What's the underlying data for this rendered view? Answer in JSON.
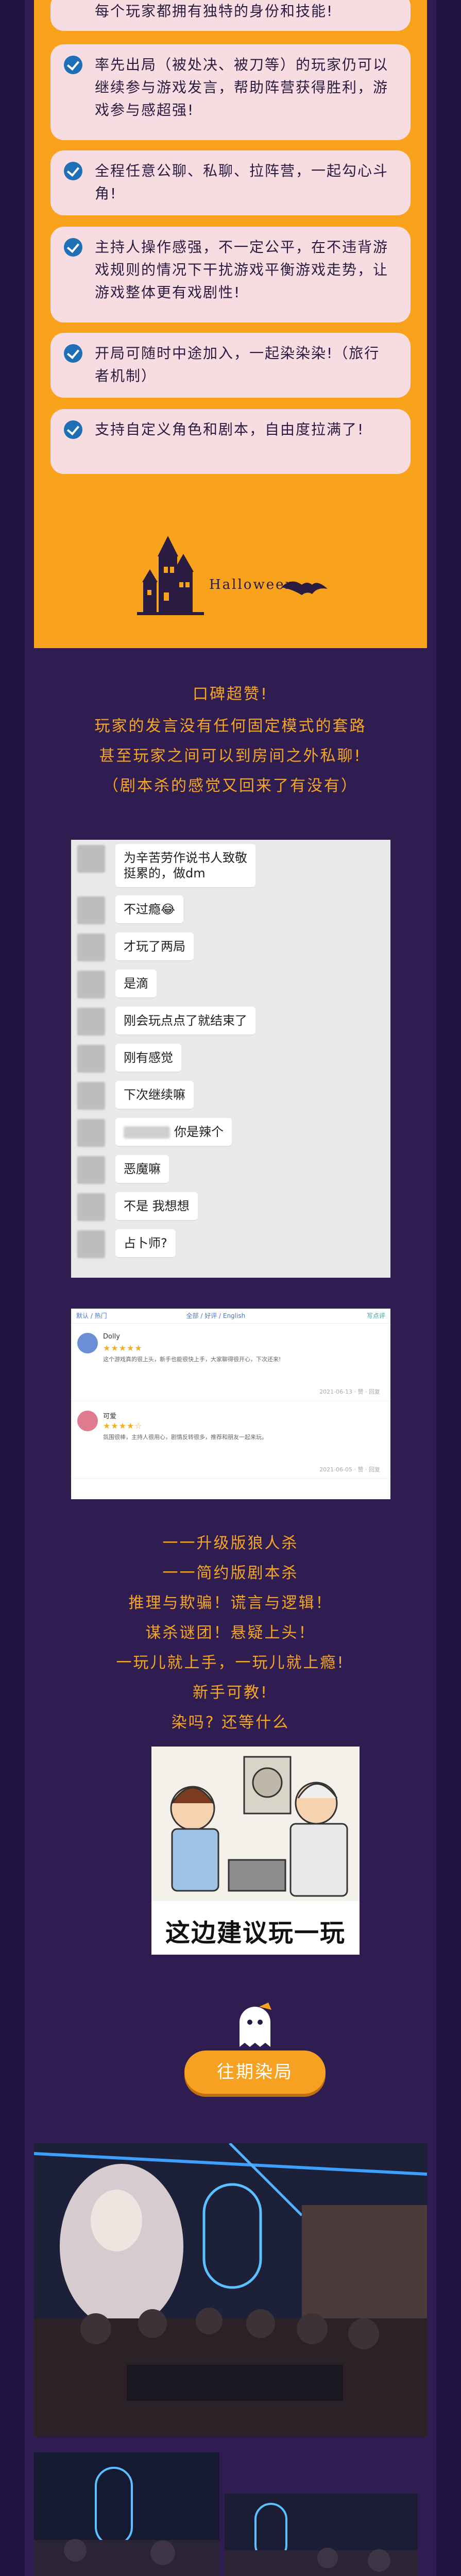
{
  "features": [
    "每个玩家都拥有独特的身份和技能!",
    "率先出局（被处决、被刀等）的玩家仍可以继续参与游戏发言，帮助阵营获得胜利，游戏参与感超强!",
    "全程任意公聊、私聊、拉阵营，一起勾心斗角!",
    "主持人操作感强，不一定公平，在不违背游戏规则的情况下干扰游戏平衡游戏走势，让游戏整体更有戏剧性!",
    "开局可随时中途加入，一起染染染!（旅行者机制）",
    "支持自定义角色和剧本，自由度拉满了!"
  ],
  "halloween_label": "Halloween",
  "praise": {
    "line1": "口碑超赞!",
    "line2": "玩家的发言没有任何固定模式的套路",
    "line3": "甚至玩家之间可以到房间之外私聊!",
    "line4": "（剧本杀的感觉又回来了有没有）"
  },
  "chat": {
    "messages": [
      {
        "text": "为辛苦劳作说书人致敬\n挺累的，做dm"
      },
      {
        "text": "不过瘾😂"
      },
      {
        "text": "才玩了两局"
      },
      {
        "text": "是滴"
      },
      {
        "text": "刚会玩点点了就结束了"
      },
      {
        "text": "刚有感觉"
      },
      {
        "text": "下次继续嘛"
      },
      {
        "text": "你是辣个"
      },
      {
        "text": "恶魔嘛"
      },
      {
        "text": "不是 我想想"
      },
      {
        "text": "占卜师?"
      }
    ]
  },
  "reviews": {
    "top_left": "默认 / 热门",
    "top_mid": "全部 / 好评 / English",
    "top_right": "写点评",
    "items": [
      {
        "name": "Dolly",
        "stars": "★★★★★",
        "body": "这个游戏真的很上头，新手也能很快上手，大家聊得很开心，下次还来!",
        "meta": "2021-06-13 · 赞 · 回复"
      },
      {
        "name": "可爱",
        "stars": "★★★★☆",
        "body": "氛围很棒，主持人很用心，剧情反转很多，推荐和朋友一起来玩。",
        "meta": "2021-06-05 · 赞 · 回复"
      }
    ]
  },
  "slogans": [
    "一一升级版狼人杀",
    "一一简约版剧本杀",
    "推理与欺骗！谎言与逻辑！",
    "谋杀谜团！悬疑上头！",
    "一玩儿就上手，一玩儿就上瘾!",
    "新手可教!",
    "染吗? 还等什么"
  ],
  "meme_caption": "这边建议玩一玩",
  "past_button": "往期染局",
  "colors": {
    "background": "#2f1d52",
    "orange": "#f9a31c",
    "accent_text": "#f5a623",
    "pill": "#f7dde2",
    "check": "#1e6fb5"
  }
}
